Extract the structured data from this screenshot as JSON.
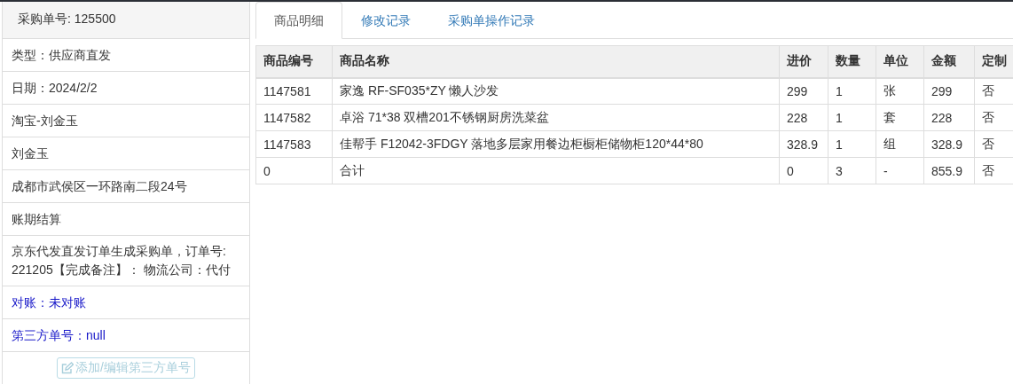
{
  "panel": {
    "title": "采购单号: 125500",
    "items": [
      {
        "kind": "text",
        "text": "类型：供应商直发"
      },
      {
        "kind": "text",
        "text": "日期：2024/2/2"
      },
      {
        "kind": "text",
        "text": "淘宝-刘金玉"
      },
      {
        "kind": "text",
        "text": "刘金玉"
      },
      {
        "kind": "text",
        "text": "成都市武侯区一环路南二段24号"
      },
      {
        "kind": "text",
        "text": "账期结算"
      },
      {
        "kind": "text",
        "text": "京东代发直发订单生成采购单，订单号: 221205【完成备注】： 物流公司：代付"
      },
      {
        "kind": "link",
        "text": "对账：未对账"
      },
      {
        "kind": "link",
        "text": "第三方单号：null"
      }
    ],
    "button": {
      "label": "添加/编辑第三方单号",
      "disabled": true
    }
  },
  "tabs": [
    {
      "label": "商品明细",
      "selected": true
    },
    {
      "label": "修改记录",
      "selected": false
    },
    {
      "label": "采购单操作记录",
      "selected": false
    }
  ],
  "table": {
    "columns": [
      "商品编号",
      "商品名称",
      "进价",
      "数量",
      "单位",
      "金额",
      "定制"
    ],
    "rows": [
      [
        "1147581",
        "家逸 RF-SF035*ZY 懒人沙发",
        "299",
        "1",
        "张",
        "299",
        "否"
      ],
      [
        "1147582",
        "卓浴 71*38 双槽201不锈钢厨房洗菜盆",
        "228",
        "1",
        "套",
        "228",
        "否"
      ],
      [
        "1147583",
        "佳帮手 F12042-3FDGY 落地多层家用餐边柜橱柜储物柜120*44*80",
        "328.9",
        "1",
        "组",
        "328.9",
        "否"
      ],
      [
        "0",
        "合计",
        "0",
        "3",
        "-",
        "855.9",
        "否"
      ]
    ]
  }
}
